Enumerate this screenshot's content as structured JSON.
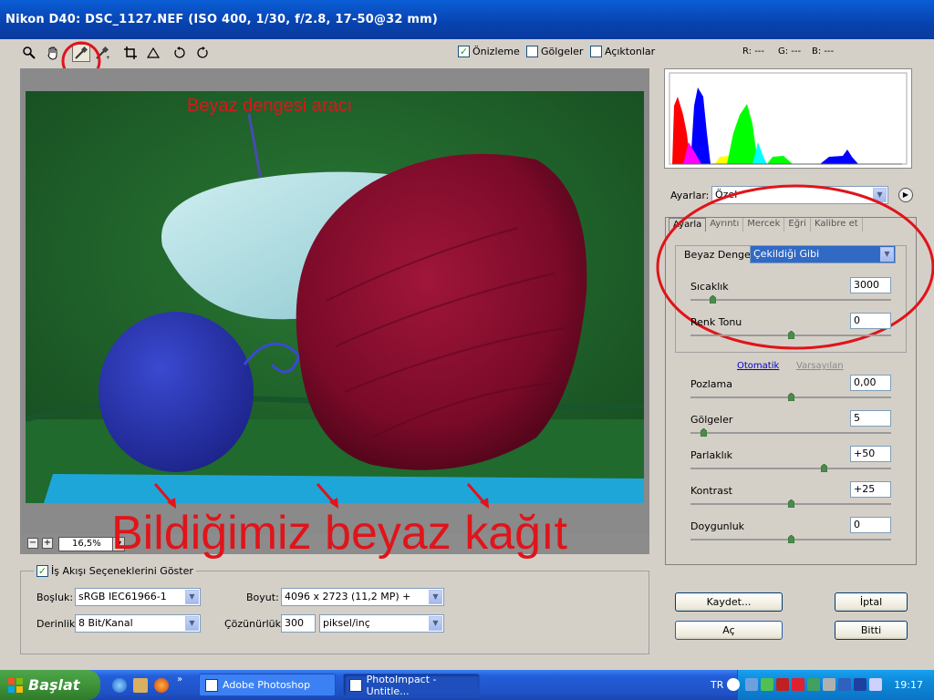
{
  "window": {
    "title": "Nikon D40:  DSC_1127.NEF  (ISO 400, 1/30, f/2.8, 17-50@32 mm)"
  },
  "toolbar": {
    "tools": [
      "zoom-icon",
      "hand-icon",
      "white-balance-eyedropper-icon",
      "color-sampler-icon",
      "crop-icon",
      "straighten-icon",
      "rotate-left-icon",
      "rotate-right-icon"
    ],
    "preview_label": "Önizleme",
    "preview_checked": true,
    "shadows_label": "Gölgeler",
    "highlights_label": "Açıktonlar",
    "r_readout": "R: ---",
    "g_readout": "G: ---",
    "b_readout": "B: ---"
  },
  "annotations": {
    "tool_label": "Beyaz dengesi aracı",
    "paper_label": "Bildiğimiz beyaz kağıt"
  },
  "zoom": {
    "value": "16,5%"
  },
  "workflow": {
    "show_label": "İş Akışı Seçeneklerini Göster",
    "space_label": "Boşluk:",
    "space_value": "sRGB IEC61966-1",
    "depth_label": "Derinlik:",
    "depth_value": "8 Bit/Kanal",
    "size_label": "Boyut:",
    "size_value": "4096 x 2723 (11,2 MP)  +",
    "resolution_label": "Çözünürlük:",
    "resolution_value": "300",
    "resolution_unit": "piksel/inç"
  },
  "settings": {
    "label": "Ayarlar:",
    "value": "Özel",
    "tabs": [
      "Ayarla",
      "Ayrıntı",
      "Mercek",
      "Eğri",
      "Kalibre et"
    ],
    "wb_label": "Beyaz Denge:",
    "wb_value": "Çekildiği Gibi",
    "auto_link": "Otomatik",
    "default_link": "Varsayılan",
    "sliders": [
      {
        "label": "Sıcaklık",
        "value": "3000",
        "level": 0.1
      },
      {
        "label": "Renk Tonu",
        "value": "0",
        "level": 0.5
      },
      {
        "label": "Pozlama",
        "value": "0,00",
        "level": 0.5
      },
      {
        "label": "Gölgeler",
        "value": "5",
        "level": 0.05
      },
      {
        "label": "Parlaklık",
        "value": "+50",
        "level": 0.67
      },
      {
        "label": "Kontrast",
        "value": "+25",
        "level": 0.5
      },
      {
        "label": "Doygunluk",
        "value": "0",
        "level": 0.5
      }
    ]
  },
  "buttons": {
    "save": "Kaydet...",
    "open": "Aç",
    "cancel": "İptal",
    "done": "Bitti"
  },
  "taskbar": {
    "start": "Başlat",
    "tasks": [
      "Adobe Photoshop",
      "PhotoImpact - Untitle..."
    ],
    "lang": "TR",
    "clock": "19:17"
  },
  "colors": {
    "annotation": "#e0141a",
    "histogram_red": "#ff0000",
    "histogram_blue": "#0000ff",
    "histogram_green": "#00ff00"
  }
}
